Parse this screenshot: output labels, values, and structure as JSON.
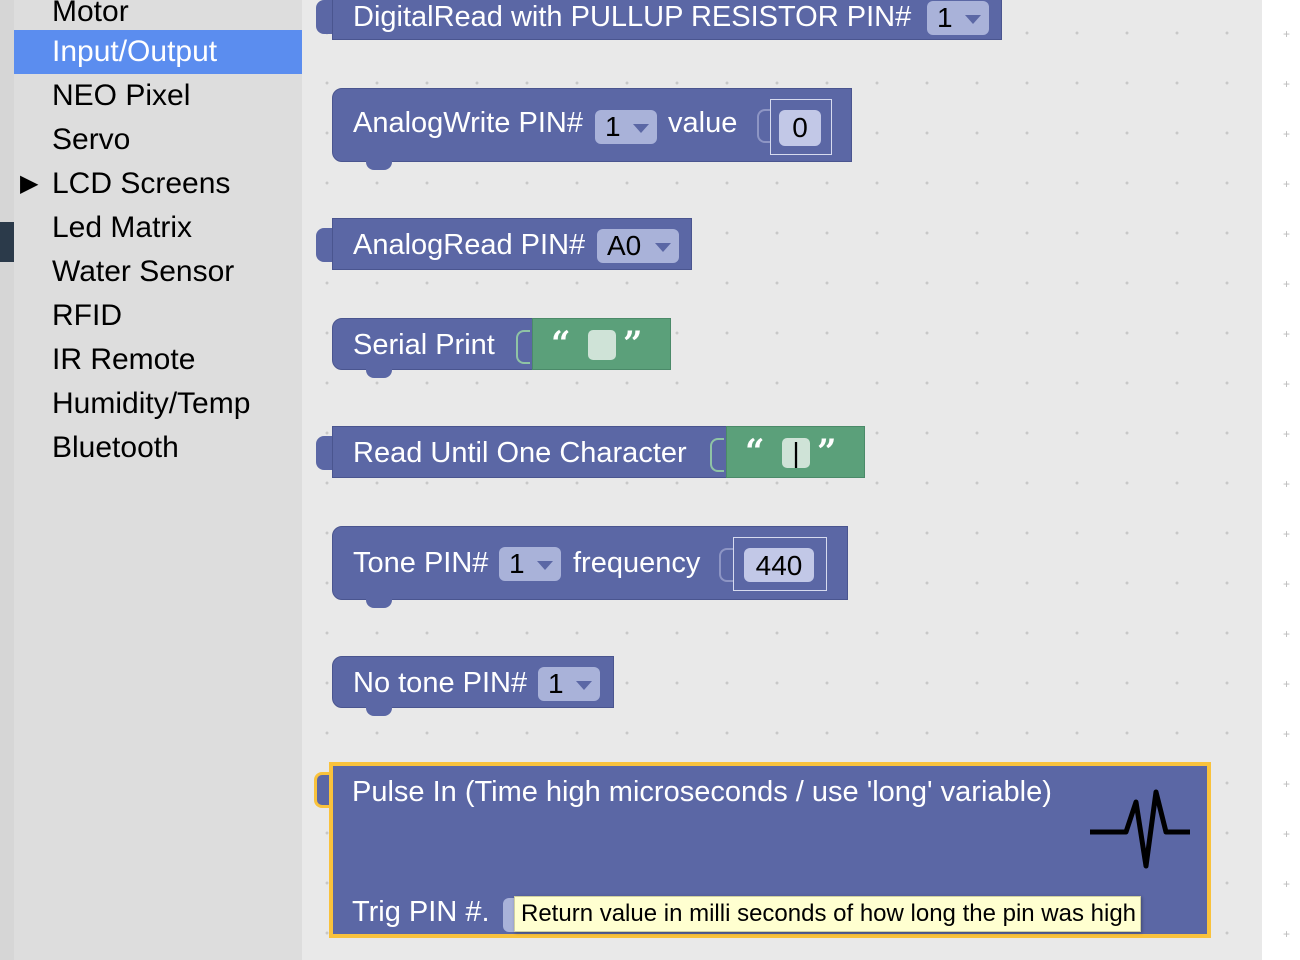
{
  "toolbox": {
    "categories": [
      {
        "label": "Motor"
      },
      {
        "label": "Input/Output",
        "selected": true
      },
      {
        "label": "NEO Pixel"
      },
      {
        "label": "Servo"
      },
      {
        "label": "LCD Screens",
        "has_submenu": true
      },
      {
        "label": "Led Matrix"
      },
      {
        "label": "Water Sensor"
      },
      {
        "label": "RFID"
      },
      {
        "label": "IR Remote"
      },
      {
        "label": "Humidity/Temp"
      },
      {
        "label": "Bluetooth"
      }
    ]
  },
  "blocks": {
    "digitalread_pullup": {
      "label": "DigitalRead with PULLUP RESISTOR PIN#",
      "pin": "1"
    },
    "analogwrite": {
      "label": "AnalogWrite PIN#",
      "pin": "1",
      "value_label": "value",
      "value": "0"
    },
    "analogread": {
      "label": "AnalogRead PIN#",
      "pin": "A0"
    },
    "serial_print": {
      "label": "Serial Print",
      "text": ""
    },
    "read_until": {
      "label": "Read Until One Character",
      "text": "|"
    },
    "tone": {
      "label": "Tone PIN#",
      "pin": "1",
      "frequency_label": "frequency",
      "frequency": "440"
    },
    "no_tone": {
      "label": "No tone PIN#",
      "pin": "1"
    },
    "pulse_in": {
      "label": "Pulse In (Time high microseconds / use 'long' variable)",
      "trig_label": "Trig PIN #.",
      "icon": "pulse-icon",
      "highlight_color": "#f9c23c"
    }
  },
  "tooltip": "Return value in milli seconds of how long the pin was high",
  "colors": {
    "block": "#5b67a5",
    "string_block": "#5ba07a",
    "selected_category": "#5b8def",
    "highlight": "#f9c23c"
  }
}
